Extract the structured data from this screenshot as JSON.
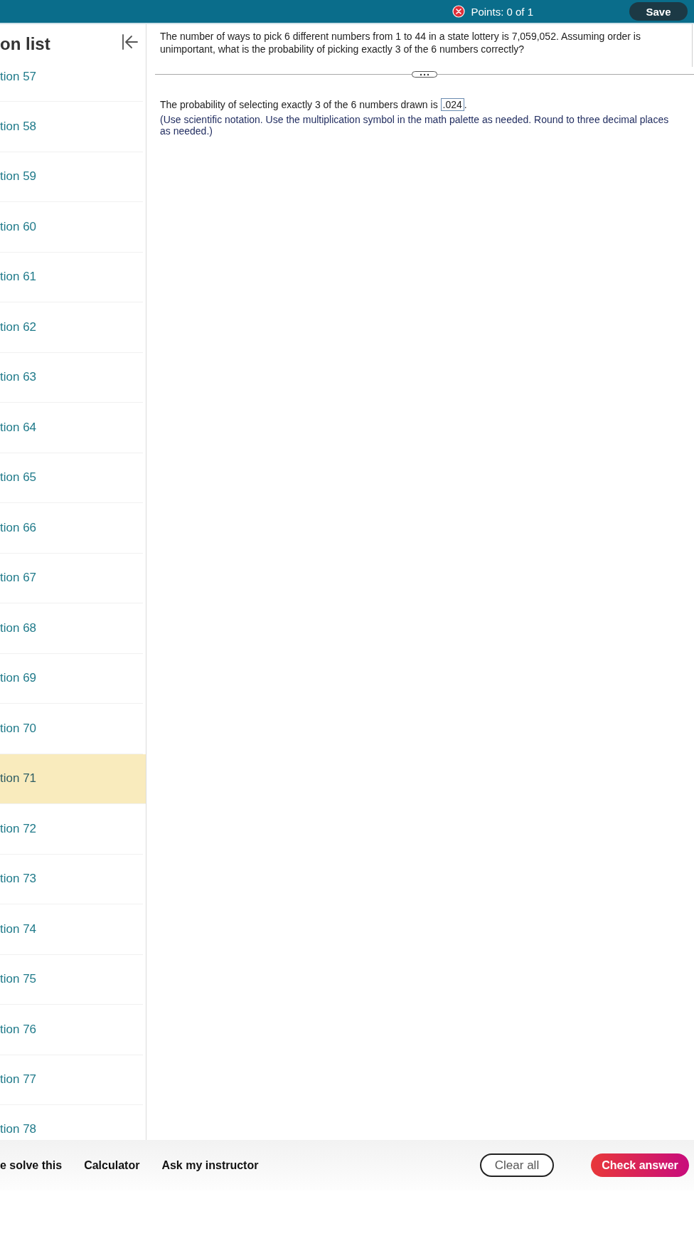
{
  "top_bar": {
    "points": "Points: 0 of 1",
    "save_button": "Save"
  },
  "question_list": {
    "title": "on list",
    "items": [
      {
        "label": "tion 57",
        "selected": false
      },
      {
        "label": "tion 58",
        "selected": false
      },
      {
        "label": "tion 59",
        "selected": false
      },
      {
        "label": "tion 60",
        "selected": false
      },
      {
        "label": "tion 61",
        "selected": false
      },
      {
        "label": "tion 62",
        "selected": false
      },
      {
        "label": "tion 63",
        "selected": false
      },
      {
        "label": "tion 64",
        "selected": false
      },
      {
        "label": "tion 65",
        "selected": false
      },
      {
        "label": "tion 66",
        "selected": false
      },
      {
        "label": "tion 67",
        "selected": false
      },
      {
        "label": "tion 68",
        "selected": false
      },
      {
        "label": "tion 69",
        "selected": false
      },
      {
        "label": "tion 70",
        "selected": false
      },
      {
        "label": "tion 71",
        "selected": true
      },
      {
        "label": "tion 72",
        "selected": false
      },
      {
        "label": "tion 73",
        "selected": false
      },
      {
        "label": "tion 74",
        "selected": false
      },
      {
        "label": "tion 75",
        "selected": false
      },
      {
        "label": "tion 76",
        "selected": false
      },
      {
        "label": "tion 77",
        "selected": false
      },
      {
        "label": "tion 78",
        "selected": false
      }
    ]
  },
  "question": {
    "text": "The number of ways to pick 6 different numbers from 1 to 44 in a state lottery is 7,059,052. Assuming order is unimportant, what is the probability of picking exactly 3 of the 6 numbers correctly?",
    "answer": {
      "prefix": "The probability of selecting exactly 3 of the 6 numbers drawn is",
      "value": ".024",
      "suffix": "."
    },
    "instructions": "(Use scientific notation. Use the multiplication symbol in the math palette as needed. Round to three decimal places as needed.)"
  },
  "bottom_bar": {
    "links": [
      "e solve this",
      "Calculator",
      "Ask my instructor"
    ],
    "clear_button": "Clear all",
    "check_button": "Check answer"
  }
}
